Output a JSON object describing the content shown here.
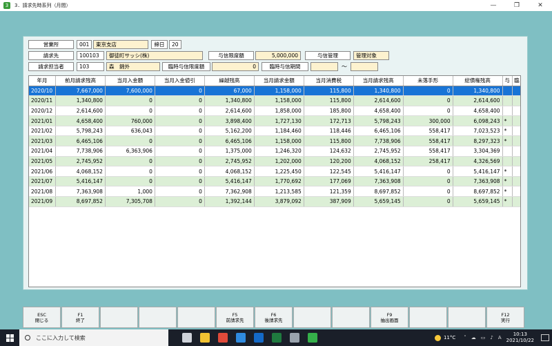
{
  "window": {
    "title": "3．請求先時系列（月間）",
    "app_icon": "green-app-icon",
    "controls": [
      "—",
      "❐",
      "✕"
    ]
  },
  "header": {
    "office_label": "営業所",
    "office_code": "001",
    "office_name": "東京支店",
    "closing_label": "締日",
    "closing_day": "20",
    "billing_label": "請求先",
    "billing_code": "100103",
    "billing_name": "御徒町サッシ(株)",
    "credit_limit_label": "与信限度額",
    "credit_limit_value": "5,000,000",
    "credit_mgmt_label": "与信管理",
    "credit_mgmt_value": "管理対象",
    "staff_label": "請求担当者",
    "staff_code": "103",
    "staff_name": "森　錦外",
    "temp_limit_label": "臨時与信限度額",
    "temp_limit_value": "0",
    "temp_period_label": "臨時与信期間",
    "temp_period_from": "",
    "tilde": "～",
    "temp_period_to": ""
  },
  "table": {
    "columns": [
      "年月",
      "前月請求残高",
      "当月入金額",
      "当月入金値引",
      "繰越残高",
      "当月請求金額",
      "当月消費税",
      "当月請求残高",
      "未落手形",
      "総債権残高",
      "与",
      "臨"
    ],
    "rows": [
      [
        "2020/10",
        "7,667,000",
        "7,600,000",
        "0",
        "67,000",
        "1,158,000",
        "115,800",
        "1,340,800",
        "0",
        "1,340,800",
        "",
        ""
      ],
      [
        "2020/11",
        "1,340,800",
        "0",
        "0",
        "1,340,800",
        "1,158,000",
        "115,800",
        "2,614,600",
        "0",
        "2,614,600",
        "",
        ""
      ],
      [
        "2020/12",
        "2,614,600",
        "0",
        "0",
        "2,614,600",
        "1,858,000",
        "185,800",
        "4,658,400",
        "0",
        "4,658,400",
        "",
        ""
      ],
      [
        "2021/01",
        "4,658,400",
        "760,000",
        "0",
        "3,898,400",
        "1,727,130",
        "172,713",
        "5,798,243",
        "300,000",
        "6,098,243",
        "*",
        ""
      ],
      [
        "2021/02",
        "5,798,243",
        "636,043",
        "0",
        "5,162,200",
        "1,184,460",
        "118,446",
        "6,465,106",
        "558,417",
        "7,023,523",
        "*",
        ""
      ],
      [
        "2021/03",
        "6,465,106",
        "0",
        "0",
        "6,465,106",
        "1,158,000",
        "115,800",
        "7,738,906",
        "558,417",
        "8,297,323",
        "*",
        ""
      ],
      [
        "2021/04",
        "7,738,906",
        "6,363,906",
        "0",
        "1,375,000",
        "1,246,320",
        "124,632",
        "2,745,952",
        "558,417",
        "3,304,369",
        "",
        ""
      ],
      [
        "2021/05",
        "2,745,952",
        "0",
        "0",
        "2,745,952",
        "1,202,000",
        "120,200",
        "4,068,152",
        "258,417",
        "4,326,569",
        "",
        ""
      ],
      [
        "2021/06",
        "4,068,152",
        "0",
        "0",
        "4,068,152",
        "1,225,450",
        "122,545",
        "5,416,147",
        "0",
        "5,416,147",
        "*",
        ""
      ],
      [
        "2021/07",
        "5,416,147",
        "0",
        "0",
        "5,416,147",
        "1,770,692",
        "177,069",
        "7,363,908",
        "0",
        "7,363,908",
        "*",
        ""
      ],
      [
        "2021/08",
        "7,363,908",
        "1,000",
        "0",
        "7,362,908",
        "1,213,585",
        "121,359",
        "8,697,852",
        "0",
        "8,697,852",
        "*",
        ""
      ],
      [
        "2021/09",
        "8,697,852",
        "7,305,708",
        "0",
        "1,392,144",
        "3,879,092",
        "387,909",
        "5,659,145",
        "0",
        "5,659,145",
        "*",
        ""
      ]
    ],
    "selected_row": 0
  },
  "fkeys": [
    {
      "key": "ESC",
      "label": "閉じる"
    },
    {
      "key": "F1",
      "label": "終了"
    },
    {
      "key": "",
      "label": ""
    },
    {
      "key": "",
      "label": ""
    },
    {
      "key": "",
      "label": ""
    },
    {
      "key": "F5",
      "label": "前請求先"
    },
    {
      "key": "F6",
      "label": "後請求先"
    },
    {
      "key": "",
      "label": ""
    },
    {
      "key": "",
      "label": ""
    },
    {
      "key": "F9",
      "label": "抽出画面"
    },
    {
      "key": "",
      "label": ""
    },
    {
      "key": "",
      "label": ""
    },
    {
      "key": "F12",
      "label": "実行"
    }
  ],
  "taskbar": {
    "search_placeholder": "ここに入力して検索",
    "weather": "11°C",
    "time": "10:13",
    "date": "2021/10/22",
    "icons": [
      {
        "name": "task-view-icon",
        "color": "#cfd3da"
      },
      {
        "name": "file-explorer-icon",
        "color": "#f1c232"
      },
      {
        "name": "chrome-icon",
        "color": "#e04a3a"
      },
      {
        "name": "edge-icon",
        "color": "#2f8be0"
      },
      {
        "name": "outlook-icon",
        "color": "#1469c7"
      },
      {
        "name": "excel-icon",
        "color": "#1f7a3f"
      },
      {
        "name": "app-icon",
        "color": "#9aa3ad"
      },
      {
        "name": "active-app-icon",
        "color": "#35b04a"
      }
    ]
  }
}
